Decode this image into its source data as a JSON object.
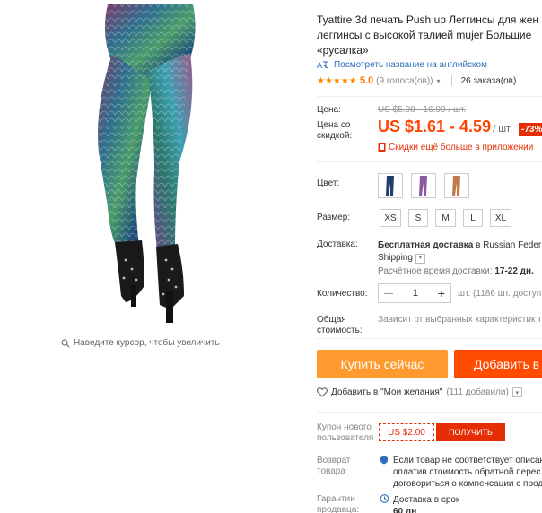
{
  "product": {
    "title": "Tyattire 3d печать Push up Леггинсы для жен леггинсы с высокой талией mujer Большие «русалка»",
    "translate_link": "Посмотреть название на английском",
    "rating": {
      "stars": "★★★★★",
      "value": "5.0",
      "votes": "(9 голоса(ов))",
      "orders": "26 заказа(ов)"
    },
    "image_hint": "Наведите курсор, чтобы увеличить"
  },
  "price": {
    "label": "Цена:",
    "old": "US $5.98 - 16.99 / шт.",
    "discount_label": "Цена со скидкой:",
    "new": "US $1.61 - 4.59",
    "unit": "/ шт.",
    "badge": "-73%",
    "app_discount": "Скидки ещё больше в приложении"
  },
  "options": {
    "color_label": "Цвет:",
    "size_label": "Размер:",
    "sizes": [
      "XS",
      "S",
      "M",
      "L",
      "XL"
    ]
  },
  "shipping": {
    "label": "Доставка:",
    "main_bold": "Бесплатная доставка",
    "main_rest": " в Russian Feder",
    "line2": "Shipping",
    "time_label": "Расчётное время доставки:",
    "time_value": "17-22 дн."
  },
  "quantity": {
    "label": "Количество:",
    "minus": "—",
    "value": "1",
    "plus": "+",
    "note": "шт. (1186 шт. доступ"
  },
  "total": {
    "label": "Общая стоимость:",
    "note": "Зависит от выбранных характеристик т"
  },
  "actions": {
    "buy_now": "Купить сейчас",
    "add_to_cart": "Добавить в",
    "wishlist": "Добавить в \"Мои желания\"",
    "wishlist_count": "(111 добавили)"
  },
  "coupon": {
    "label": "Купон нового пользователя",
    "value": "US $2.00",
    "button": "ПОЛУЧИТЬ"
  },
  "returns": {
    "label": "Возврат товара",
    "text": "Если товар не соответствует описан оплатив стоимость обратной перес договориться о компенсации с прод"
  },
  "guarantee": {
    "label": "Гарантии продавца:",
    "line1": "Доставка в срок",
    "line2": "60 дн"
  },
  "colors": {
    "accent": "#ff4400",
    "buy": "#ff9a2e",
    "cart": "#ff4c00",
    "badge": "#e62e04",
    "link": "#2a6ebb"
  }
}
